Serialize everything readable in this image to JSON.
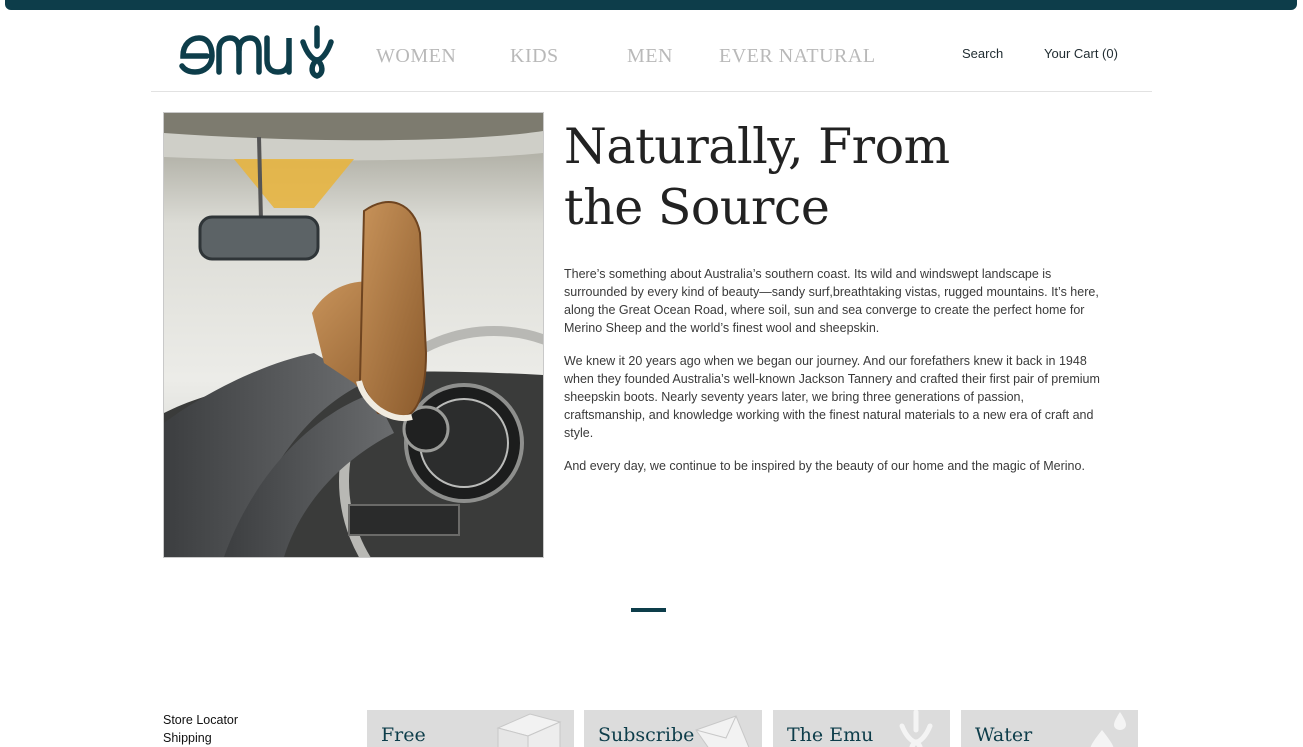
{
  "header": {
    "brand": "emu",
    "nav": [
      {
        "label": "WOMEN"
      },
      {
        "label": "KIDS"
      },
      {
        "label": "MEN"
      },
      {
        "label": "EVER NATURAL"
      }
    ],
    "search_label": "Search",
    "cart_label": "Your Cart (0)"
  },
  "hero": {
    "headline_line1": "Naturally, From",
    "headline_line2": "the Source",
    "paragraphs": [
      "There’s something about Australia’s southern coast. Its wild and windswept landscape is surrounded by every kind of beauty—sandy surf,breathtaking vistas, rugged mountains. It’s here, along the Great Ocean Road, where soil, sun and sea converge to create the perfect home for Merino Sheep and the world’s finest wool and sheepskin.",
      "We knew it 20 years ago when we began our journey. And our forefathers knew it back in 1948 when they founded Australia’s well-known Jackson Tannery and crafted their first pair of premium sheepskin boots. Nearly seventy years later, we bring three generations of passion, craftsmanship, and knowledge working with the finest natural materials to a new era of craft and style.",
      "And every day, we continue to be inspired by the beauty of our home and the magic of Merino."
    ]
  },
  "footer": {
    "links": [
      "Store Locator",
      "Shipping"
    ],
    "tiles": [
      {
        "label": "Free",
        "icon": "box-icon"
      },
      {
        "label": "Subscribe",
        "icon": "envelope-icon"
      },
      {
        "label": "The Emu",
        "icon": "emu-logo-icon"
      },
      {
        "label": "Water",
        "icon": "water-drop-icon"
      }
    ]
  },
  "colors": {
    "brand": "#0d3d4a",
    "nav_text": "#b9b9b9",
    "tile_bg": "#dcdcdc"
  }
}
